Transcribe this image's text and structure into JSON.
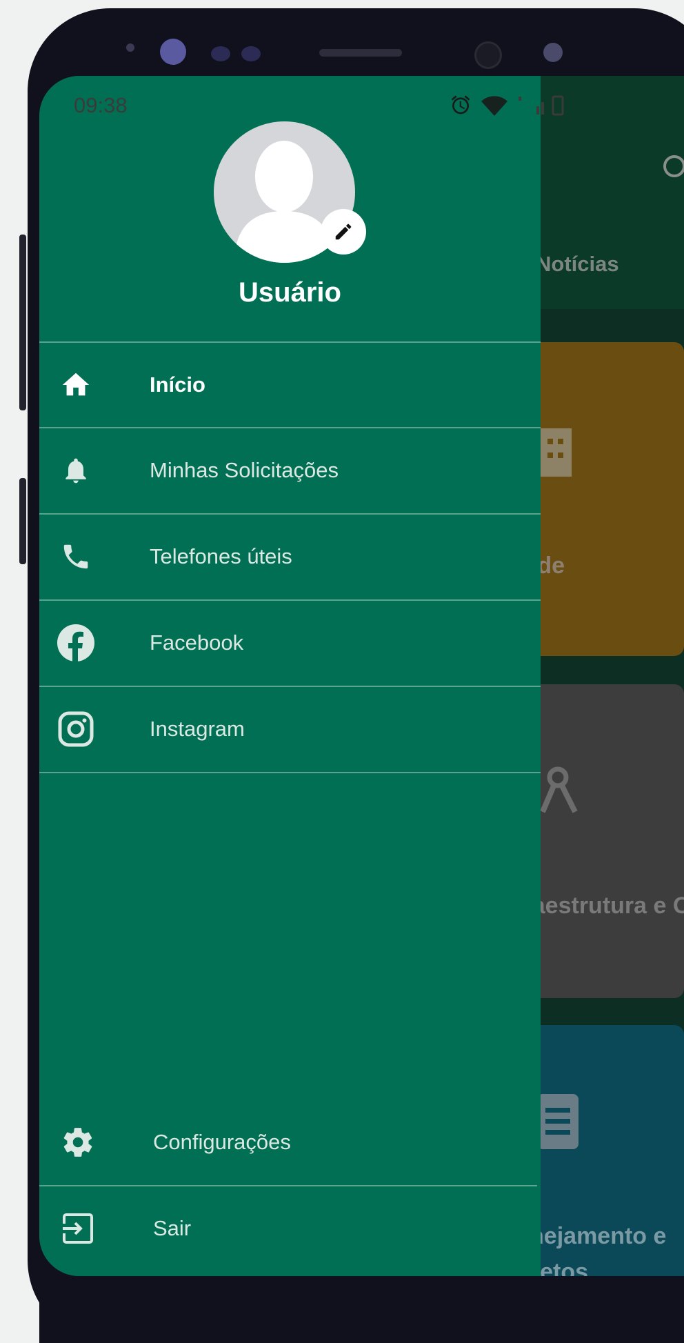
{
  "status_bar": {
    "time": "09:38"
  },
  "user": {
    "name": "Usuário"
  },
  "menu": {
    "items": [
      {
        "label": "Início",
        "icon": "home-icon",
        "active": true
      },
      {
        "label": "Minhas Solicitações",
        "icon": "bell-icon"
      },
      {
        "label": "Telefones úteis",
        "icon": "phone-icon"
      },
      {
        "label": "Facebook",
        "icon": "facebook-icon"
      },
      {
        "label": "Instagram",
        "icon": "instagram-icon"
      }
    ],
    "bottom_items": [
      {
        "label": "Configurações",
        "icon": "gear-icon"
      },
      {
        "label": "Sair",
        "icon": "logout-icon"
      }
    ]
  },
  "background_screen": {
    "header_tab": "Notícias",
    "cards": [
      {
        "label": "Saúde",
        "color": "#6a4d10"
      },
      {
        "label": "Infraestrutura e Obras",
        "color": "#3d3d3d"
      },
      {
        "label": "Planejamento e Projetos",
        "color": "#0b4858"
      }
    ]
  },
  "colors": {
    "drawer": "#016f53",
    "text": "#ffffff"
  }
}
